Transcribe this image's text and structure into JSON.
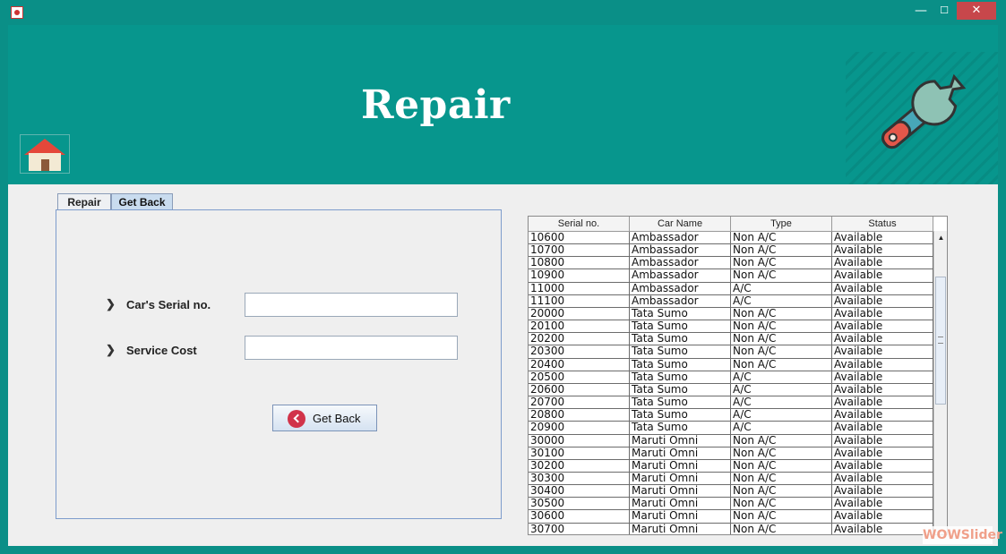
{
  "window": {
    "min_label": "—",
    "max_label": "☐",
    "close_label": "✕"
  },
  "header": {
    "title": "Repair"
  },
  "tabs": [
    {
      "label": "Repair",
      "selected": false
    },
    {
      "label": "Get Back",
      "selected": true
    }
  ],
  "form": {
    "serial_label": "Car's Serial no.",
    "serial_value": "",
    "cost_label": "Service Cost",
    "cost_value": "",
    "submit_label": "Get Back"
  },
  "table": {
    "columns": [
      "Serial no.",
      "Car Name",
      "Type",
      "Status"
    ],
    "rows": [
      [
        "10600",
        "Ambassador",
        "Non A/C",
        "Available"
      ],
      [
        "10700",
        "Ambassador",
        "Non A/C",
        "Available"
      ],
      [
        "10800",
        "Ambassador",
        "Non A/C",
        "Available"
      ],
      [
        "10900",
        "Ambassador",
        "Non A/C",
        "Available"
      ],
      [
        "11000",
        "Ambassador",
        "A/C",
        "Available"
      ],
      [
        "11100",
        "Ambassador",
        "A/C",
        "Available"
      ],
      [
        "20000",
        "Tata Sumo",
        "Non A/C",
        "Available"
      ],
      [
        "20100",
        "Tata Sumo",
        "Non A/C",
        "Available"
      ],
      [
        "20200",
        "Tata Sumo",
        "Non A/C",
        "Available"
      ],
      [
        "20300",
        "Tata Sumo",
        "Non A/C",
        "Available"
      ],
      [
        "20400",
        "Tata Sumo",
        "Non A/C",
        "Available"
      ],
      [
        "20500",
        "Tata Sumo",
        "A/C",
        "Available"
      ],
      [
        "20600",
        "Tata Sumo",
        "A/C",
        "Available"
      ],
      [
        "20700",
        "Tata Sumo",
        "A/C",
        "Available"
      ],
      [
        "20800",
        "Tata Sumo",
        "A/C",
        "Available"
      ],
      [
        "20900",
        "Tata Sumo",
        "A/C",
        "Available"
      ],
      [
        "30000",
        "Maruti Omni",
        "Non A/C",
        "Available"
      ],
      [
        "30100",
        "Maruti Omni",
        "Non A/C",
        "Available"
      ],
      [
        "30200",
        "Maruti Omni",
        "Non A/C",
        "Available"
      ],
      [
        "30300",
        "Maruti Omni",
        "Non A/C",
        "Available"
      ],
      [
        "30400",
        "Maruti Omni",
        "Non A/C",
        "Available"
      ],
      [
        "30500",
        "Maruti Omni",
        "Non A/C",
        "Available"
      ],
      [
        "30600",
        "Maruti Omni",
        "Non A/C",
        "Available"
      ],
      [
        "30700",
        "Maruti Omni",
        "Non A/C",
        "Available"
      ]
    ]
  },
  "watermark": "WOWSlider",
  "colors": {
    "header_bg": "#07968d",
    "close_button": "#c7474b",
    "get_back_icon": "#d1334a"
  },
  "icons": {
    "app": "java-app-icon",
    "home": "home-icon",
    "header_art": "wrench-icon",
    "button": "chevron-left-circle-icon"
  }
}
